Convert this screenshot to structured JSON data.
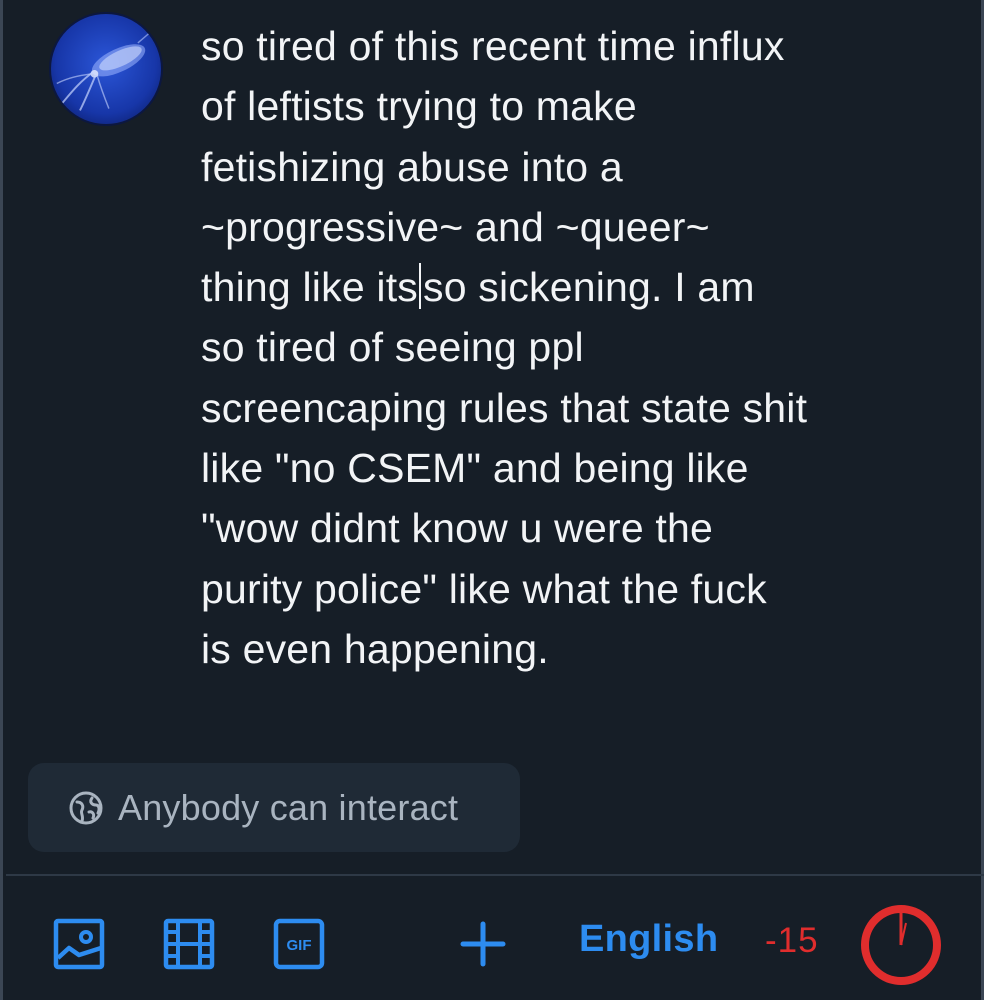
{
  "post": {
    "text_before_caret": "so tired of this recent time influx\nof leftists trying to make\nfetishizing abuse into a\n~progressive~ and ~queer~\nthing like its",
    "text_after_caret": "so sickening. I am\nso tired of seeing ppl\nscreencaping rules that state shit\nlike \"no CSEM\" and being like\n\"wow didnt know u were the\npurity police\" like what the fuck\nis even happening."
  },
  "avatar": {
    "icon": "squid-avatar",
    "color": "#1c3fb8"
  },
  "interaction": {
    "label": "Anybody can interact",
    "icon": "globe-icon"
  },
  "toolbar": {
    "image_icon": "image-icon",
    "video_icon": "film-icon",
    "gif_label": "GIF",
    "add_icon": "plus-icon",
    "language": "English",
    "remaining_chars": "-15",
    "accent_color": "#2d8cf0",
    "over_limit_color": "#e02d2d"
  }
}
